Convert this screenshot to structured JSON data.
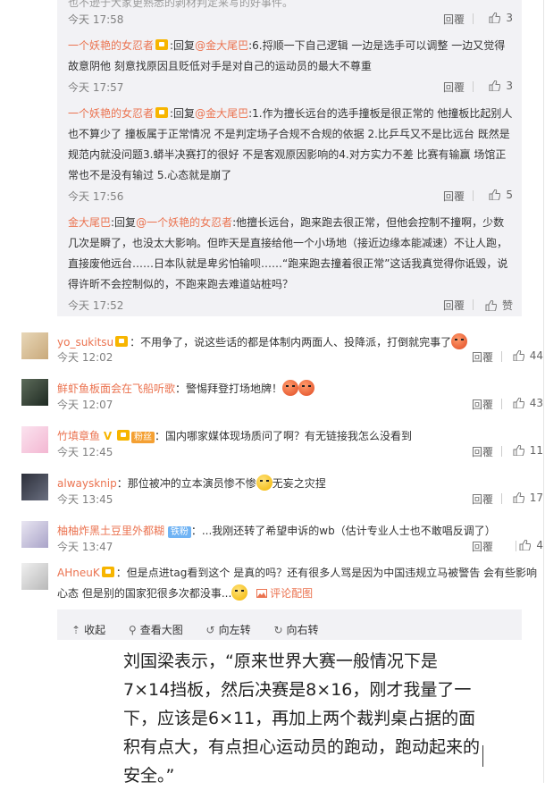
{
  "top_partial": {
    "text": "也不逊于大家更熟悉的剥材判定来写的好事件。",
    "time": "今天 17:58",
    "reply_label": "回覆",
    "likes": "3"
  },
  "replies": [
    {
      "user": "一个妖艳的女忍者",
      "reply_word": ":回复",
      "at_user": "@金大尾巴",
      "text": ":6.捋顺一下自己逻辑 一边是选手可以调整 一边又觉得故意阴他 刻意找原因且贬低对手是对自己的运动员的最大不尊重",
      "time": "今天 17:57",
      "reply_label": "回覆",
      "likes": "3"
    },
    {
      "user": "一个妖艳的女忍者",
      "reply_word": ":回复",
      "at_user": "@金大尾巴",
      "text": ":1.作为擅长远台的选手撞板是很正常的 他撞板比起别人也不算少了 撞板属于正常情况 不是判定场子合规不合规的依据 2.比乒乓又不是比远台 既然是规范内就没问题3.蟒半决赛打的很好 不是客观原因影响的4.对方实力不差 比赛有输赢 场馆正常也不是没有输过 5.心态就是崩了",
      "time": "今天 17:56",
      "reply_label": "回覆",
      "likes": "5"
    },
    {
      "user": "金大尾巴",
      "reply_word": ":回复",
      "at_user": "@一个妖艳的女忍者",
      "text": ":他擅长远台，跑来跑去很正常，但他会控制不撞啊，少数几次是瞬了，也没太大影响。但昨天是直接给他一个小场地（接近边缘本能减速）不让人跑，直接废他远台……日本队就是卑劣怕输呗……“跑来跑去撞着很正常”这话我真觉得你诋毁，说得许昕不会控制似的，不跑来跑去难道站桩吗？",
      "time": "今天 17:52",
      "reply_label": "回覆",
      "likes": "赞"
    }
  ],
  "comments": [
    {
      "user": "yo_sukitsu",
      "text": "：不用争了，说这些话的都是体制内两面人、投降派，打倒就完事了",
      "time": "今天 12:02",
      "reply_label": "回覆",
      "likes": "44"
    },
    {
      "user": "鲜虾鱼板面会在飞船听歌",
      "text": "：警惕拜登打场地牌！",
      "time": "今天 12:07",
      "reply_label": "回覆",
      "likes": "43"
    },
    {
      "user": "竹填章鱼",
      "badge": "粉丝",
      "text": "：国内哪家媒体现场质问了啊？有无链接我怎么没看到",
      "time": "今天 12:45",
      "reply_label": "回覆",
      "likes": "11"
    },
    {
      "user": "alwaysknip",
      "text_a": "：那位被冲的立本演员惨不惨",
      "text_b": "无妄之灾捏",
      "time": "今天 13:45",
      "reply_label": "回覆",
      "likes": "17"
    },
    {
      "user": "柚柚炸黑土豆里外都糊",
      "badge": "铁粉",
      "text": "：...我刚还转了希望申诉的wb（估计专业人士也不敢唱反调了）",
      "time": "今天 13:47",
      "reply_label": "回覆",
      "likes": "4"
    },
    {
      "user": "AHneuK",
      "text": "：但是点进tag看到这个 是真的吗？还有很多人骂是因为中国违规立马被警告 会有些影响心态 但是别的国家犯很多次都没事...",
      "pic_link": "评论配图"
    }
  ],
  "pic_toolbar": {
    "collapse": "收起",
    "view_large": "查看大图",
    "rotate_left": "向左转",
    "rotate_right": "向右转"
  },
  "pic_text": "刘国梁表示，“原来世界大赛一般情况下是7×14挡板，然后决赛是8×16，刚才我量了一下，应该是6×11，再加上两个裁判桌占据的面积有点大，有点担心运动员的跑动，跑动起来的安全。”",
  "colors": {
    "link": "#eb7350",
    "meta": "#808080",
    "reply_bg": "#f2f2f5"
  }
}
